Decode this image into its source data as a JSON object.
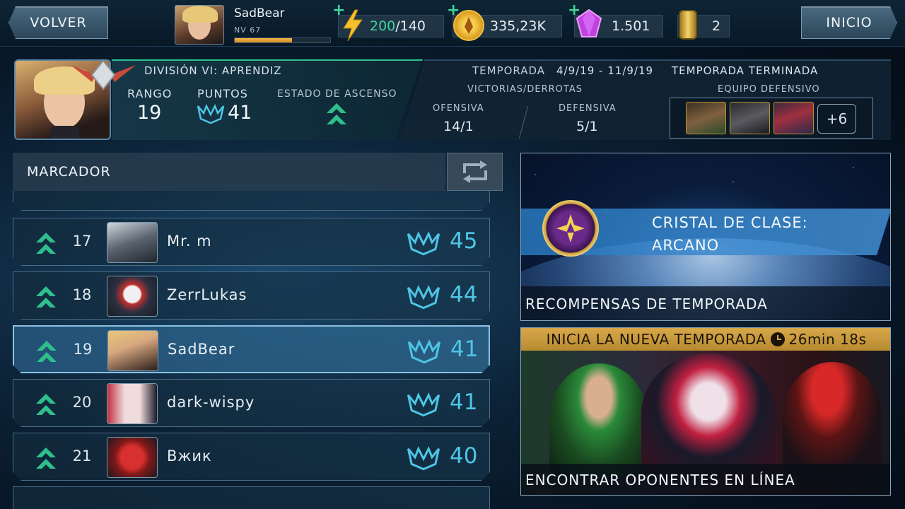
{
  "topbar": {
    "back_label": "VOLVER",
    "home_label": "INICIO",
    "player": {
      "name": "SadBear",
      "level": "NV 67",
      "xp_fraction": 0.6
    },
    "energy": {
      "current": "200",
      "max": "/140"
    },
    "coins": "335,23K",
    "gems": "1.501",
    "tickets": "2"
  },
  "rank": {
    "division": "DIVISIÓN VI: APRENDIZ",
    "rank_label": "RANGO",
    "rank_value": "19",
    "points_label": "PUNTOS",
    "points_value": "41",
    "promotion_label": "ESTADO DE ASCENSO"
  },
  "season": {
    "season_label": "TEMPORADA",
    "dates": "4/9/19 - 11/9/19",
    "status": "TEMPORADA TERMINADA",
    "wl_label": "VICTORIAS/DERROTAS",
    "offense_label": "OFENSIVA",
    "offense_value": "14/1",
    "defense_label": "DEFENSIVA",
    "defense_value": "5/1",
    "defense_team_label": "EQUIPO DEFENSIVO",
    "defense_extra": "+6"
  },
  "leaderboard": {
    "title": "MARCADOR",
    "rows": [
      {
        "rank": "17",
        "name": "Mr. m",
        "points": "45"
      },
      {
        "rank": "18",
        "name": "ZerrLukas",
        "points": "44"
      },
      {
        "rank": "19",
        "name": "SadBear",
        "points": "41"
      },
      {
        "rank": "20",
        "name": "dark-wispy",
        "points": "41"
      },
      {
        "rank": "21",
        "name": "Вжик",
        "points": "40"
      }
    ]
  },
  "rewards": {
    "crystal_line1": "CRISTAL DE CLASE:",
    "crystal_line2": "ARCANO",
    "caption": "RECOMPENSAS DE TEMPORADA"
  },
  "new_season": {
    "banner": "INICIA LA NUEVA TEMPORADA",
    "timer": "26min 18s",
    "caption": "ENCONTRAR OPONENTES EN LÍNEA"
  },
  "colors": {
    "accent_green": "#3fd59a",
    "points_blue": "#4ec6e6",
    "gold_banner": "#d8a84a"
  }
}
